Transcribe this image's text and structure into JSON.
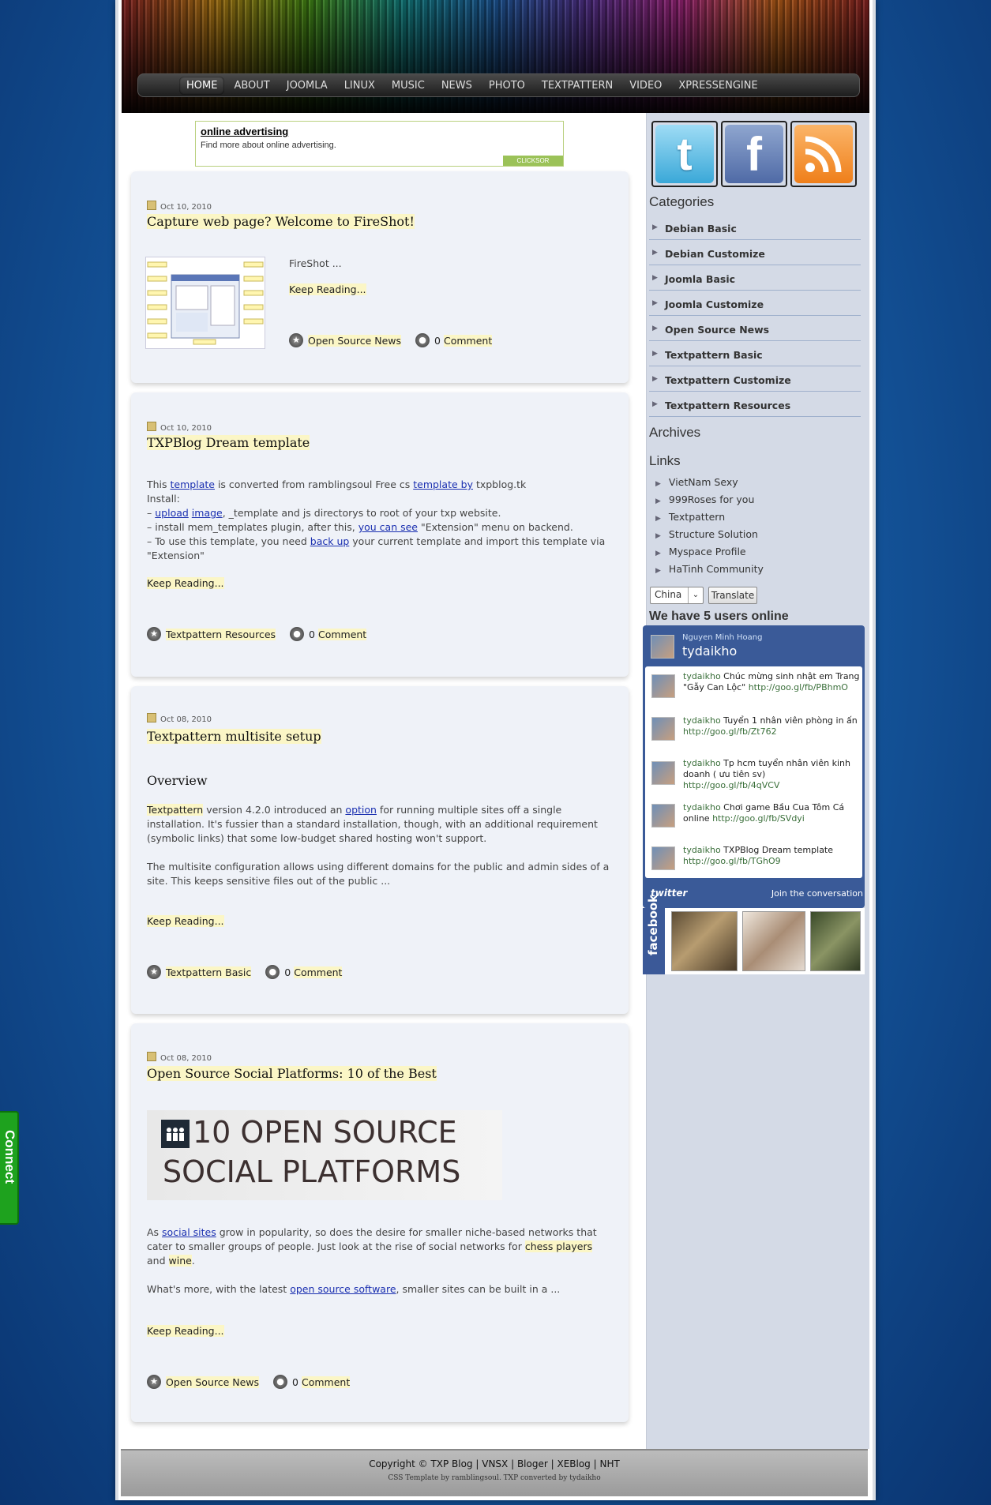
{
  "nav": {
    "items": [
      "HOME",
      "ABOUT",
      "JOOMLA",
      "LINUX",
      "MUSIC",
      "NEWS",
      "PHOTO",
      "TEXTPATTERN",
      "VIDEO",
      "XPRESSENGINE"
    ]
  },
  "ad": {
    "title": "online advertising",
    "desc": "Find more about online advertising.",
    "badge": "CLICKSOR"
  },
  "posts": [
    {
      "date": "Oct 10, 2010",
      "title": "Capture web page? Welcome to FireShot!",
      "excerpt": "FireShot ...",
      "keep": "Keep Reading...",
      "category": "Open Source News",
      "comment_count": "0",
      "comment_label": "Comment"
    },
    {
      "date": "Oct 10, 2010",
      "title": "TXPBlog Dream template",
      "line1": [
        "This ",
        "template",
        " is converted from ramblingsoul Free cs ",
        "template by",
        " txpblog.tk"
      ],
      "line2": "Install:",
      "line3": [
        "– ",
        "upload",
        " ",
        "image",
        ", _template and js directorys to root of your txp website."
      ],
      "line4": [
        "– install mem_templates plugin, after this, ",
        "you can see",
        " \"Extension\" menu on backend."
      ],
      "line5": [
        "– To use this template, you need ",
        "back up",
        " your current template and import this template via \"Extension\""
      ],
      "keep": "Keep Reading...",
      "category": "Textpattern Resources",
      "comment_count": "0",
      "comment_label": "Comment"
    },
    {
      "date": "Oct 08, 2010",
      "title": "Textpattern multisite setup",
      "subheading": "Overview",
      "p1": [
        "Textpattern",
        " version 4.2.0 introduced an ",
        "option",
        " for running multiple sites off a single installation. It's fussier than a standard installation, though, with an additional requirement (symbolic links) that some low-budget shared hosting won't support."
      ],
      "p2": "The multisite configuration allows using different domains for the public and admin sides of a site. This keeps sensitive files out of the public ...",
      "keep": "Keep Reading...",
      "category": "Textpattern Basic",
      "comment_count": "0",
      "comment_label": "Comment"
    },
    {
      "date": "Oct 08, 2010",
      "title": "Open Source Social Platforms: 10 of the Best",
      "banner_line1": "10 OPEN SOURCE",
      "banner_line2": "SOCIAL PLATFORMS",
      "p1": [
        "As ",
        "social sites",
        " grow in popularity, so does the desire for smaller niche-based networks that cater to smaller groups of people. Just look at the rise of social networks for ",
        "chess players",
        " and ",
        "wine",
        "."
      ],
      "p2": [
        "What's more, with the latest ",
        "open source software",
        ", smaller sites can be built in a ..."
      ],
      "keep": "Keep Reading...",
      "category": "Open Source News",
      "comment_count": "0",
      "comment_label": "Comment"
    }
  ],
  "sidebar": {
    "social": [
      "twitter-icon",
      "facebook-icon",
      "rss-icon"
    ],
    "categories_title": "Categories",
    "categories": [
      "Debian Basic",
      "Debian Customize",
      "Joomla Basic",
      "Joomla Customize",
      "Open Source News",
      "Textpattern Basic",
      "Textpattern Customize",
      "Textpattern Resources"
    ],
    "archives_title": "Archives",
    "links_title": "Links",
    "links": [
      "VietNam Sexy",
      "999Roses for you",
      "Textpattern",
      "Structure Solution",
      "Myspace Profile",
      "HaTinh Community"
    ],
    "translate_select": "China",
    "translate_button": "Translate",
    "online": "We have 5 users online"
  },
  "twitter": {
    "name_small": "Nguyen Minh Hoang",
    "name_big": "tydaikho",
    "tweets": [
      {
        "user": "tydaikho",
        "text": " Chúc mừng sinh nhật em Trang \"Gẫy Can Lộc\" ",
        "link": "http://goo.gl/fb/PBhmO"
      },
      {
        "user": "tydaikho",
        "text": " Tuyển 1 nhân viên phòng in ấn ",
        "link": "http://goo.gl/fb/Zt762"
      },
      {
        "user": "tydaikho",
        "text": " Tp hcm tuyển nhân viên kinh doanh ( ưu tiên sv) ",
        "link": "http://goo.gl/fb/4qVCV"
      },
      {
        "user": "tydaikho",
        "text": " Chơi game Bầu Cua Tôm Cá online ",
        "link": "http://goo.gl/fb/SVdyi"
      },
      {
        "user": "tydaikho",
        "text": " TXPBlog Dream template ",
        "link": "http://goo.gl/fb/TGhO9"
      }
    ],
    "brand": "twitter",
    "join": "Join the conversation"
  },
  "facebook": {
    "label": "facebook"
  },
  "footer": {
    "copyright": "Copyright © TXP Blog | ",
    "links": [
      "VNSX",
      "Bloger",
      "XEBlog",
      "NHT"
    ],
    "credit": "CSS Template by ramblingsoul. TXP converted by tydaikho"
  },
  "connect": {
    "label": "Connect"
  }
}
